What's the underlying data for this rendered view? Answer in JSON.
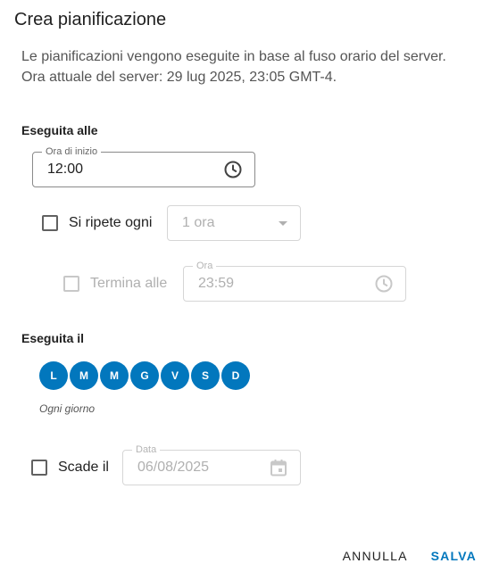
{
  "dialog": {
    "title": "Crea pianificazione",
    "description_line1": "Le pianificazioni vengono eseguite in base al fuso orario del server.",
    "description_line2": "Ora attuale del server: 29 lug 2025, 23:05 GMT-4."
  },
  "runs_at": {
    "section_label": "Eseguita alle",
    "start_time_label": "Ora di inizio",
    "start_time_value": "12:00",
    "start_time_icon": "clock-icon",
    "repeat_label": "Si ripete ogni",
    "repeat_checked": false,
    "repeat_interval": "1 ora",
    "end_label": "Termina alle",
    "end_checked": false,
    "end_time_label": "Ora",
    "end_time_value": "23:59"
  },
  "runs_on": {
    "section_label": "Eseguita il",
    "days": [
      "L",
      "M",
      "M",
      "G",
      "V",
      "S",
      "D"
    ],
    "days_caption": "Ogni giorno"
  },
  "expires": {
    "label": "Scade il",
    "checked": false,
    "date_label": "Data",
    "date_value": "06/08/2025",
    "date_icon": "calendar-icon"
  },
  "actions": {
    "cancel_label": "ANNULLA",
    "save_label": "SALVA"
  },
  "colors": {
    "accent": "#0277bd",
    "text": "#212121",
    "disabled_text": "#b0b0b0"
  }
}
